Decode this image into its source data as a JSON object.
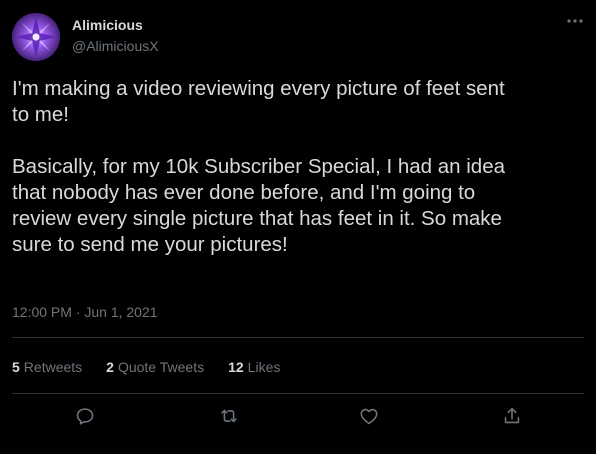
{
  "tweet": {
    "display_name": "Alimicious",
    "handle": "@AlimiciousX",
    "text": "I'm making a video reviewing every picture of feet sent\nto me!\n\nBasically, for my 10k Subscriber Special, I had an idea\nthat nobody has ever done before, and I'm going to\nreview every single picture that has feet in it. So make\nsure to send me your pictures!",
    "timestamp": "12:00 PM · Jun 1, 2021"
  },
  "stats": {
    "retweets": {
      "count": "5",
      "label": "Retweets"
    },
    "quote_tweets": {
      "count": "2",
      "label": "Quote Tweets"
    },
    "likes": {
      "count": "12",
      "label": "Likes"
    }
  },
  "actions": {
    "reply_icon": "reply-icon",
    "retweet_icon": "retweet-icon",
    "like_icon": "heart-icon",
    "share_icon": "share-icon"
  },
  "colors": {
    "background": "#000000",
    "text": "#d9d9d9",
    "secondary": "#6e767d",
    "divider": "#2f3336",
    "avatar_purple": "#7a3fd1"
  }
}
